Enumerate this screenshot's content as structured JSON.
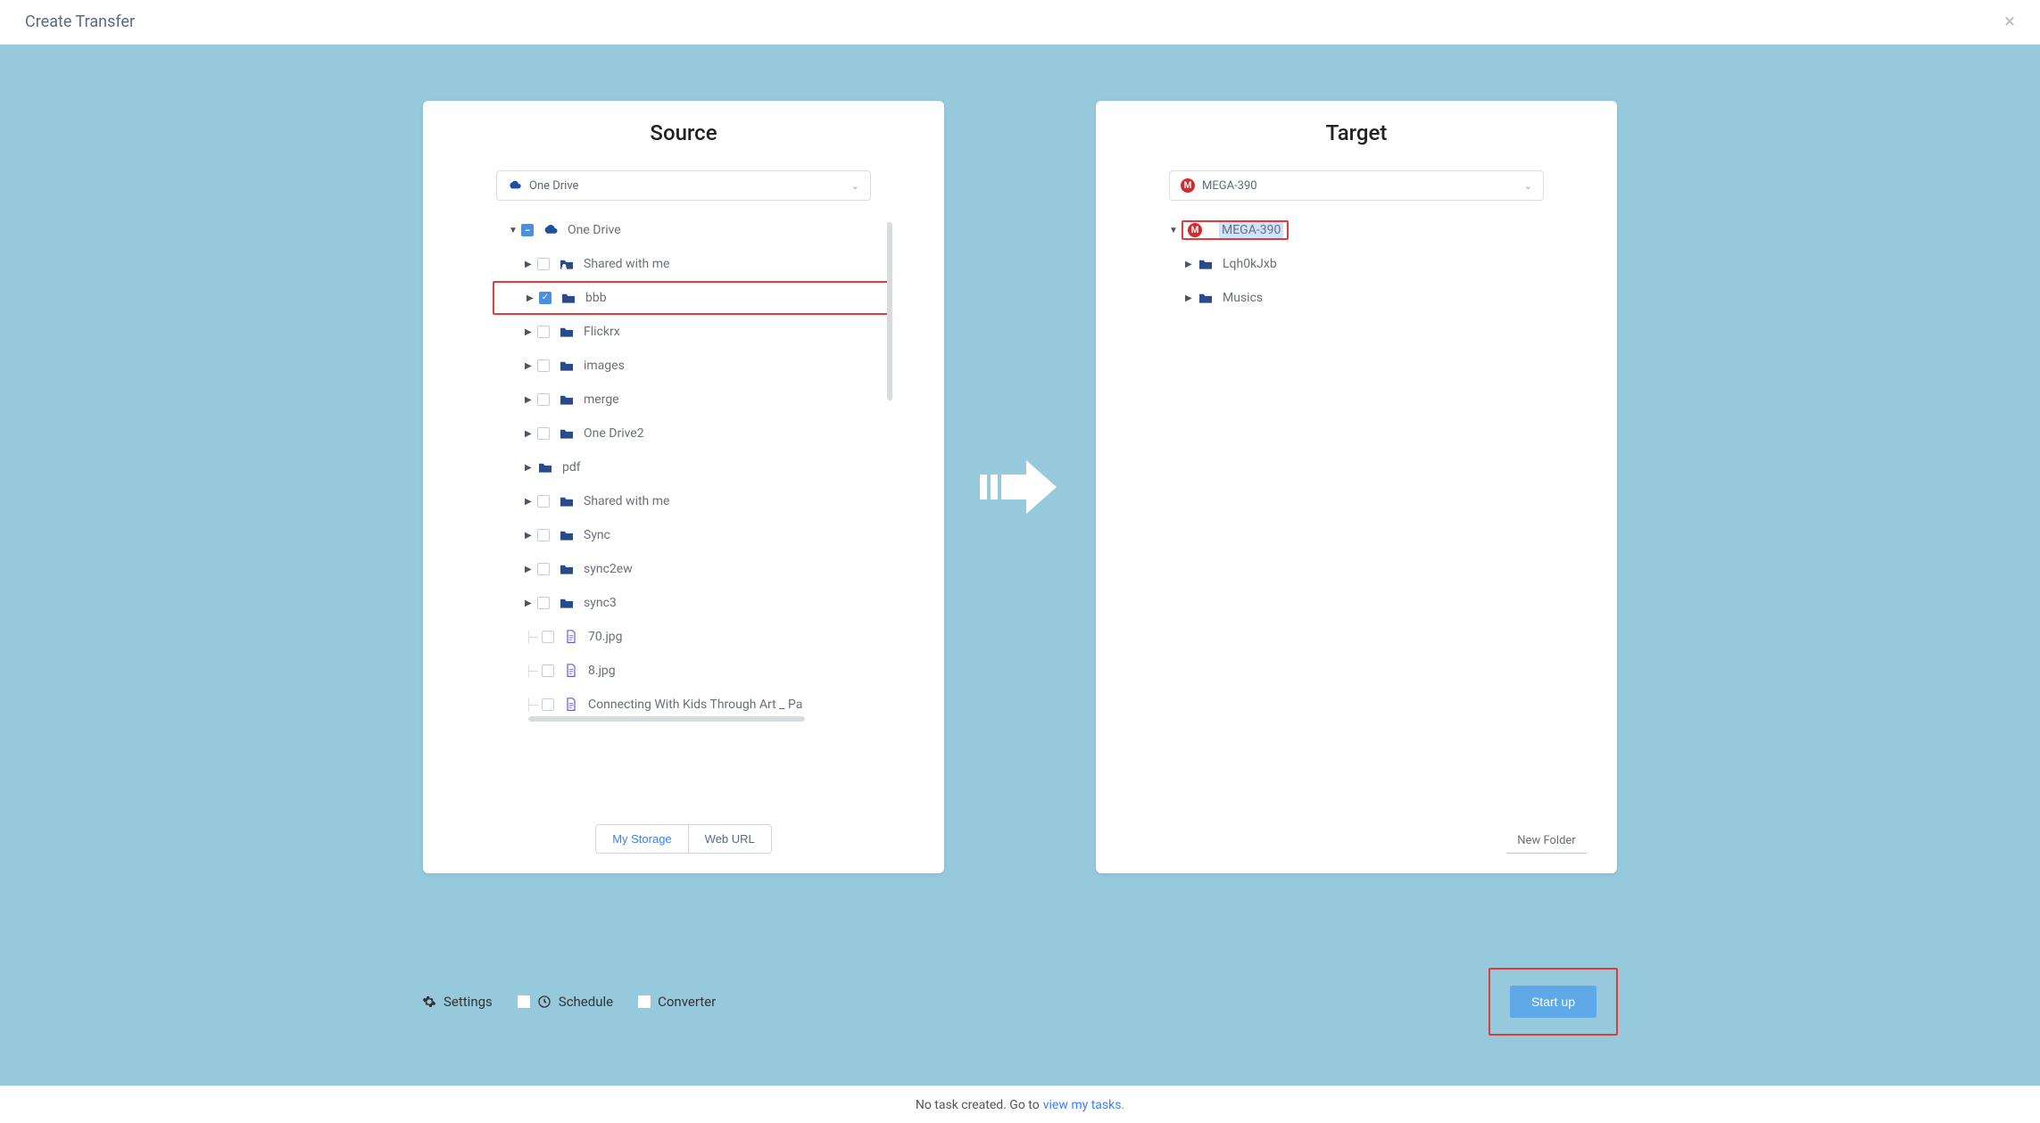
{
  "header": {
    "title": "Create Transfer"
  },
  "source": {
    "title": "Source",
    "selector": {
      "label": "One Drive",
      "iconColor": "#2b4a8b"
    },
    "root": {
      "label": "One Drive"
    },
    "items": [
      {
        "label": "Shared with me",
        "icon": "personfolder",
        "checked": false
      },
      {
        "label": "bbb",
        "icon": "folder",
        "checked": true,
        "highlight": true
      },
      {
        "label": "Flickrx",
        "icon": "folder",
        "checked": false
      },
      {
        "label": "images",
        "icon": "folder",
        "checked": false
      },
      {
        "label": "merge",
        "icon": "folder",
        "checked": false
      },
      {
        "label": "One Drive2",
        "icon": "folder",
        "checked": false
      },
      {
        "label": "pdf",
        "icon": "folder",
        "checked": false,
        "noCaret": false
      },
      {
        "label": "Shared with me",
        "icon": "folder",
        "checked": false
      },
      {
        "label": "Sync",
        "icon": "folder",
        "checked": false
      },
      {
        "label": "sync2ew",
        "icon": "folder",
        "checked": false
      },
      {
        "label": "sync3",
        "icon": "folder",
        "checked": false
      }
    ],
    "files": [
      {
        "label": "70.jpg"
      },
      {
        "label": "8.jpg"
      },
      {
        "label": "Connecting With Kids Through Art _ Pa"
      }
    ],
    "tabs": {
      "my": "My Storage",
      "web": "Web URL"
    }
  },
  "target": {
    "title": "Target",
    "selector": {
      "label": "MEGA-390"
    },
    "root": {
      "label": "MEGA-390"
    },
    "items": [
      {
        "label": "Lqh0kJxb"
      },
      {
        "label": "Musics"
      }
    ],
    "newFolder": "New Folder"
  },
  "options": {
    "settings": "Settings",
    "schedule": "Schedule",
    "converter": "Converter",
    "start": "Start up"
  },
  "footer": {
    "text": "No task created. Go to",
    "link": "view my tasks."
  }
}
